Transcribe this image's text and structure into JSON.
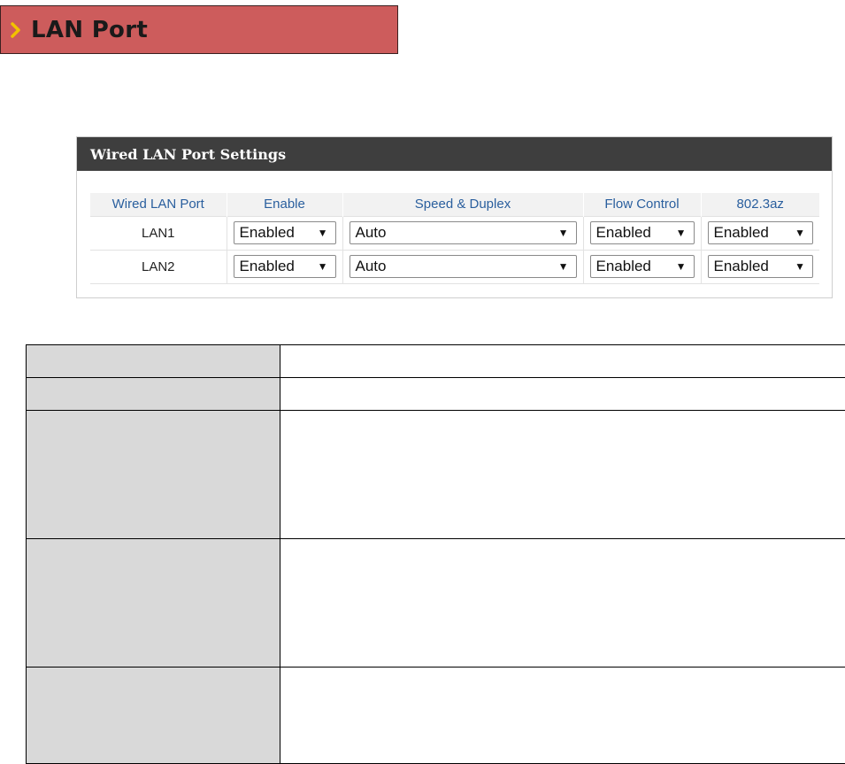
{
  "section": {
    "title": "LAN Port",
    "icon": "chevron-right-icon",
    "background_color": "#cd5c5c",
    "chevron_color": "#f2c200"
  },
  "panel": {
    "header": "Wired LAN Port Settings",
    "header_background": "#3e3e3e",
    "columns": [
      "Wired LAN Port",
      "Enable",
      "Speed & Duplex",
      "Flow Control",
      "802.3az"
    ],
    "rows": [
      {
        "port": "LAN1",
        "enable": "Enabled",
        "speed_duplex": "Auto",
        "flow_control": "Enabled",
        "eee": "Enabled"
      },
      {
        "port": "LAN2",
        "enable": "Enabled",
        "speed_duplex": "Auto",
        "flow_control": "Enabled",
        "eee": "Enabled"
      }
    ]
  },
  "description_table": {
    "rows": [
      {
        "label": "",
        "value": ""
      },
      {
        "label": "",
        "value": ""
      },
      {
        "label": "",
        "value": ""
      },
      {
        "label": "",
        "value": ""
      },
      {
        "label": "",
        "value": ""
      }
    ]
  }
}
